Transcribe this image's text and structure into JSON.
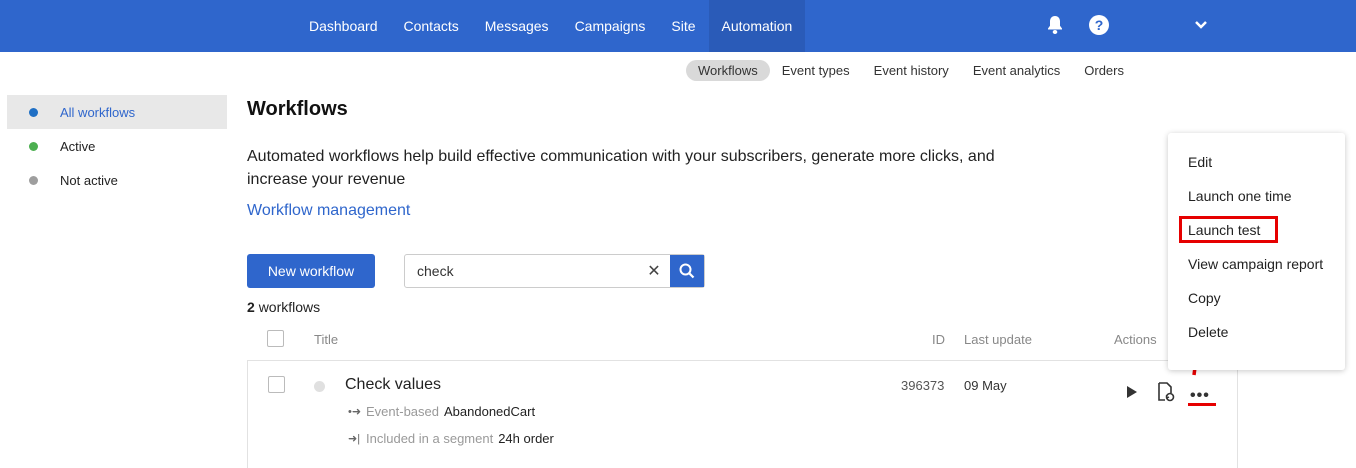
{
  "topnav": {
    "items": [
      "Dashboard",
      "Contacts",
      "Messages",
      "Campaigns",
      "Site",
      "Automation"
    ],
    "active": "Automation"
  },
  "subnav": {
    "items": [
      "Workflows",
      "Event types",
      "Event history",
      "Event analytics",
      "Orders"
    ],
    "active": "Workflows"
  },
  "sidebar": {
    "items": [
      {
        "label": "All workflows",
        "color": "#1f6fc4"
      },
      {
        "label": "Active",
        "color": "#4caf50"
      },
      {
        "label": "Not active",
        "color": "#9e9e9e"
      }
    ]
  },
  "main": {
    "title": "Workflows",
    "description": "Automated workflows help build effective communication with your subscribers, generate more clicks, and increase your revenue",
    "link": "Workflow management",
    "new_button": "New workflow",
    "search_value": "check",
    "count_number": "2",
    "count_label": "workflows"
  },
  "table": {
    "headers": {
      "title": "Title",
      "id": "ID",
      "last_update": "Last update",
      "actions": "Actions"
    },
    "rows": [
      {
        "title": "Check values",
        "id": "396373",
        "date": "09 May",
        "trigger_label": "Event-based",
        "trigger_value": "AbandonedCart",
        "segment_label": "Included in a segment",
        "segment_value": "24h order"
      }
    ]
  },
  "dropdown": {
    "items": [
      "Edit",
      "Launch one time",
      "Launch test",
      "View campaign report",
      "Copy",
      "Delete"
    ],
    "highlighted": "Launch test"
  },
  "annotation_color": "#e60000",
  "accent_color": "#2f66cc"
}
